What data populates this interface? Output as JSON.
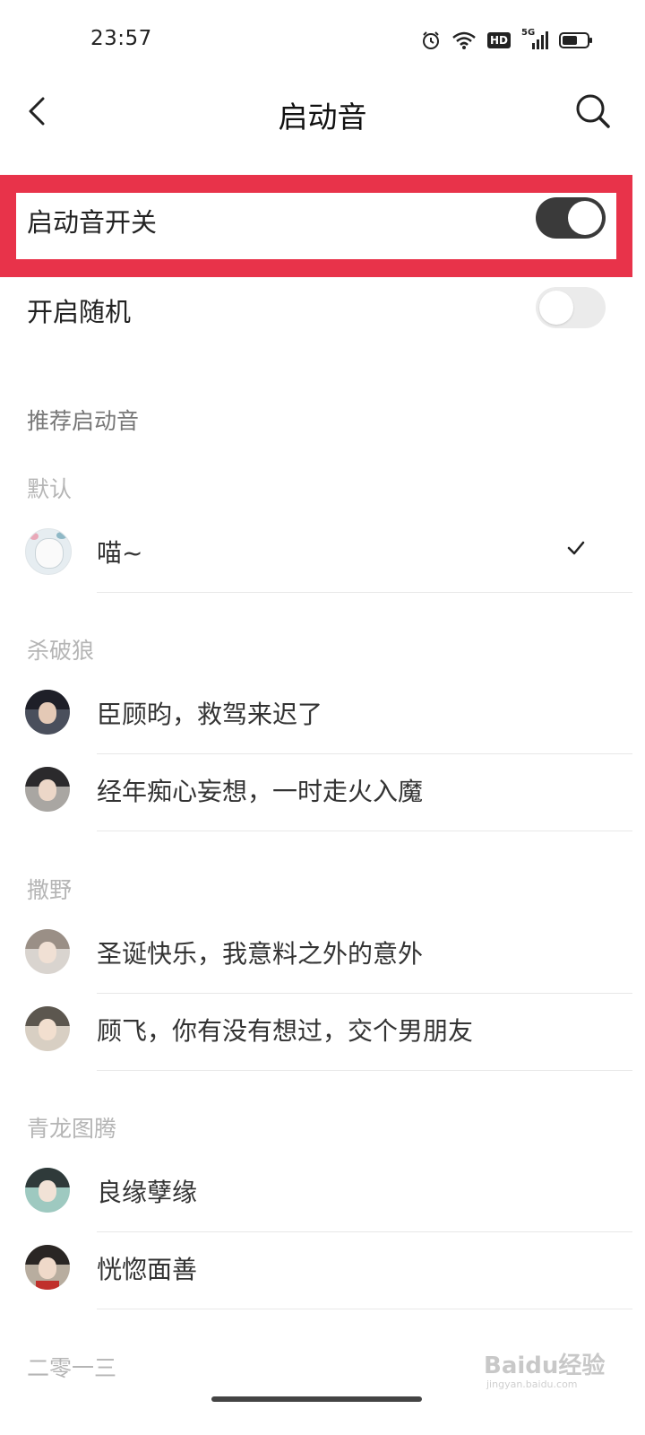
{
  "status_bar": {
    "time": "23:57",
    "icons": [
      "alarm-icon",
      "wifi-icon",
      "hd-icon",
      "5g-signal-icon",
      "battery-icon"
    ],
    "hd_label": "HD",
    "network_label": "5G"
  },
  "header": {
    "title": "启动音",
    "back_icon": "chevron-left-icon",
    "search_icon": "search-icon"
  },
  "settings": {
    "startup_sound_switch": {
      "label": "启动音开关",
      "on": true
    },
    "random_switch": {
      "label": "开启随机",
      "on": false
    }
  },
  "recommended_heading": "推荐启动音",
  "groups": [
    {
      "name": "默认",
      "items": [
        {
          "title": "喵~",
          "selected": true
        }
      ]
    },
    {
      "name": "杀破狼",
      "items": [
        {
          "title": "臣顾昀，救驾来迟了"
        },
        {
          "title": "经年痴心妄想，一时走火入魔"
        }
      ]
    },
    {
      "name": "撒野",
      "items": [
        {
          "title": "圣诞快乐，我意料之外的意外"
        },
        {
          "title": "顾飞，你有没有想过，交个男朋友"
        }
      ]
    },
    {
      "name": "青龙图腾",
      "items": [
        {
          "title": "良缘孽缘"
        },
        {
          "title": "恍惚面善"
        }
      ]
    },
    {
      "name": "二零一三",
      "items": []
    }
  ],
  "watermark": {
    "text": "Baidu经验",
    "sub": "jingyan.baidu.com"
  },
  "colors": {
    "highlight": "#e8334a",
    "toggle_on": "#3a3a3a",
    "toggle_off": "#ebebeb"
  }
}
